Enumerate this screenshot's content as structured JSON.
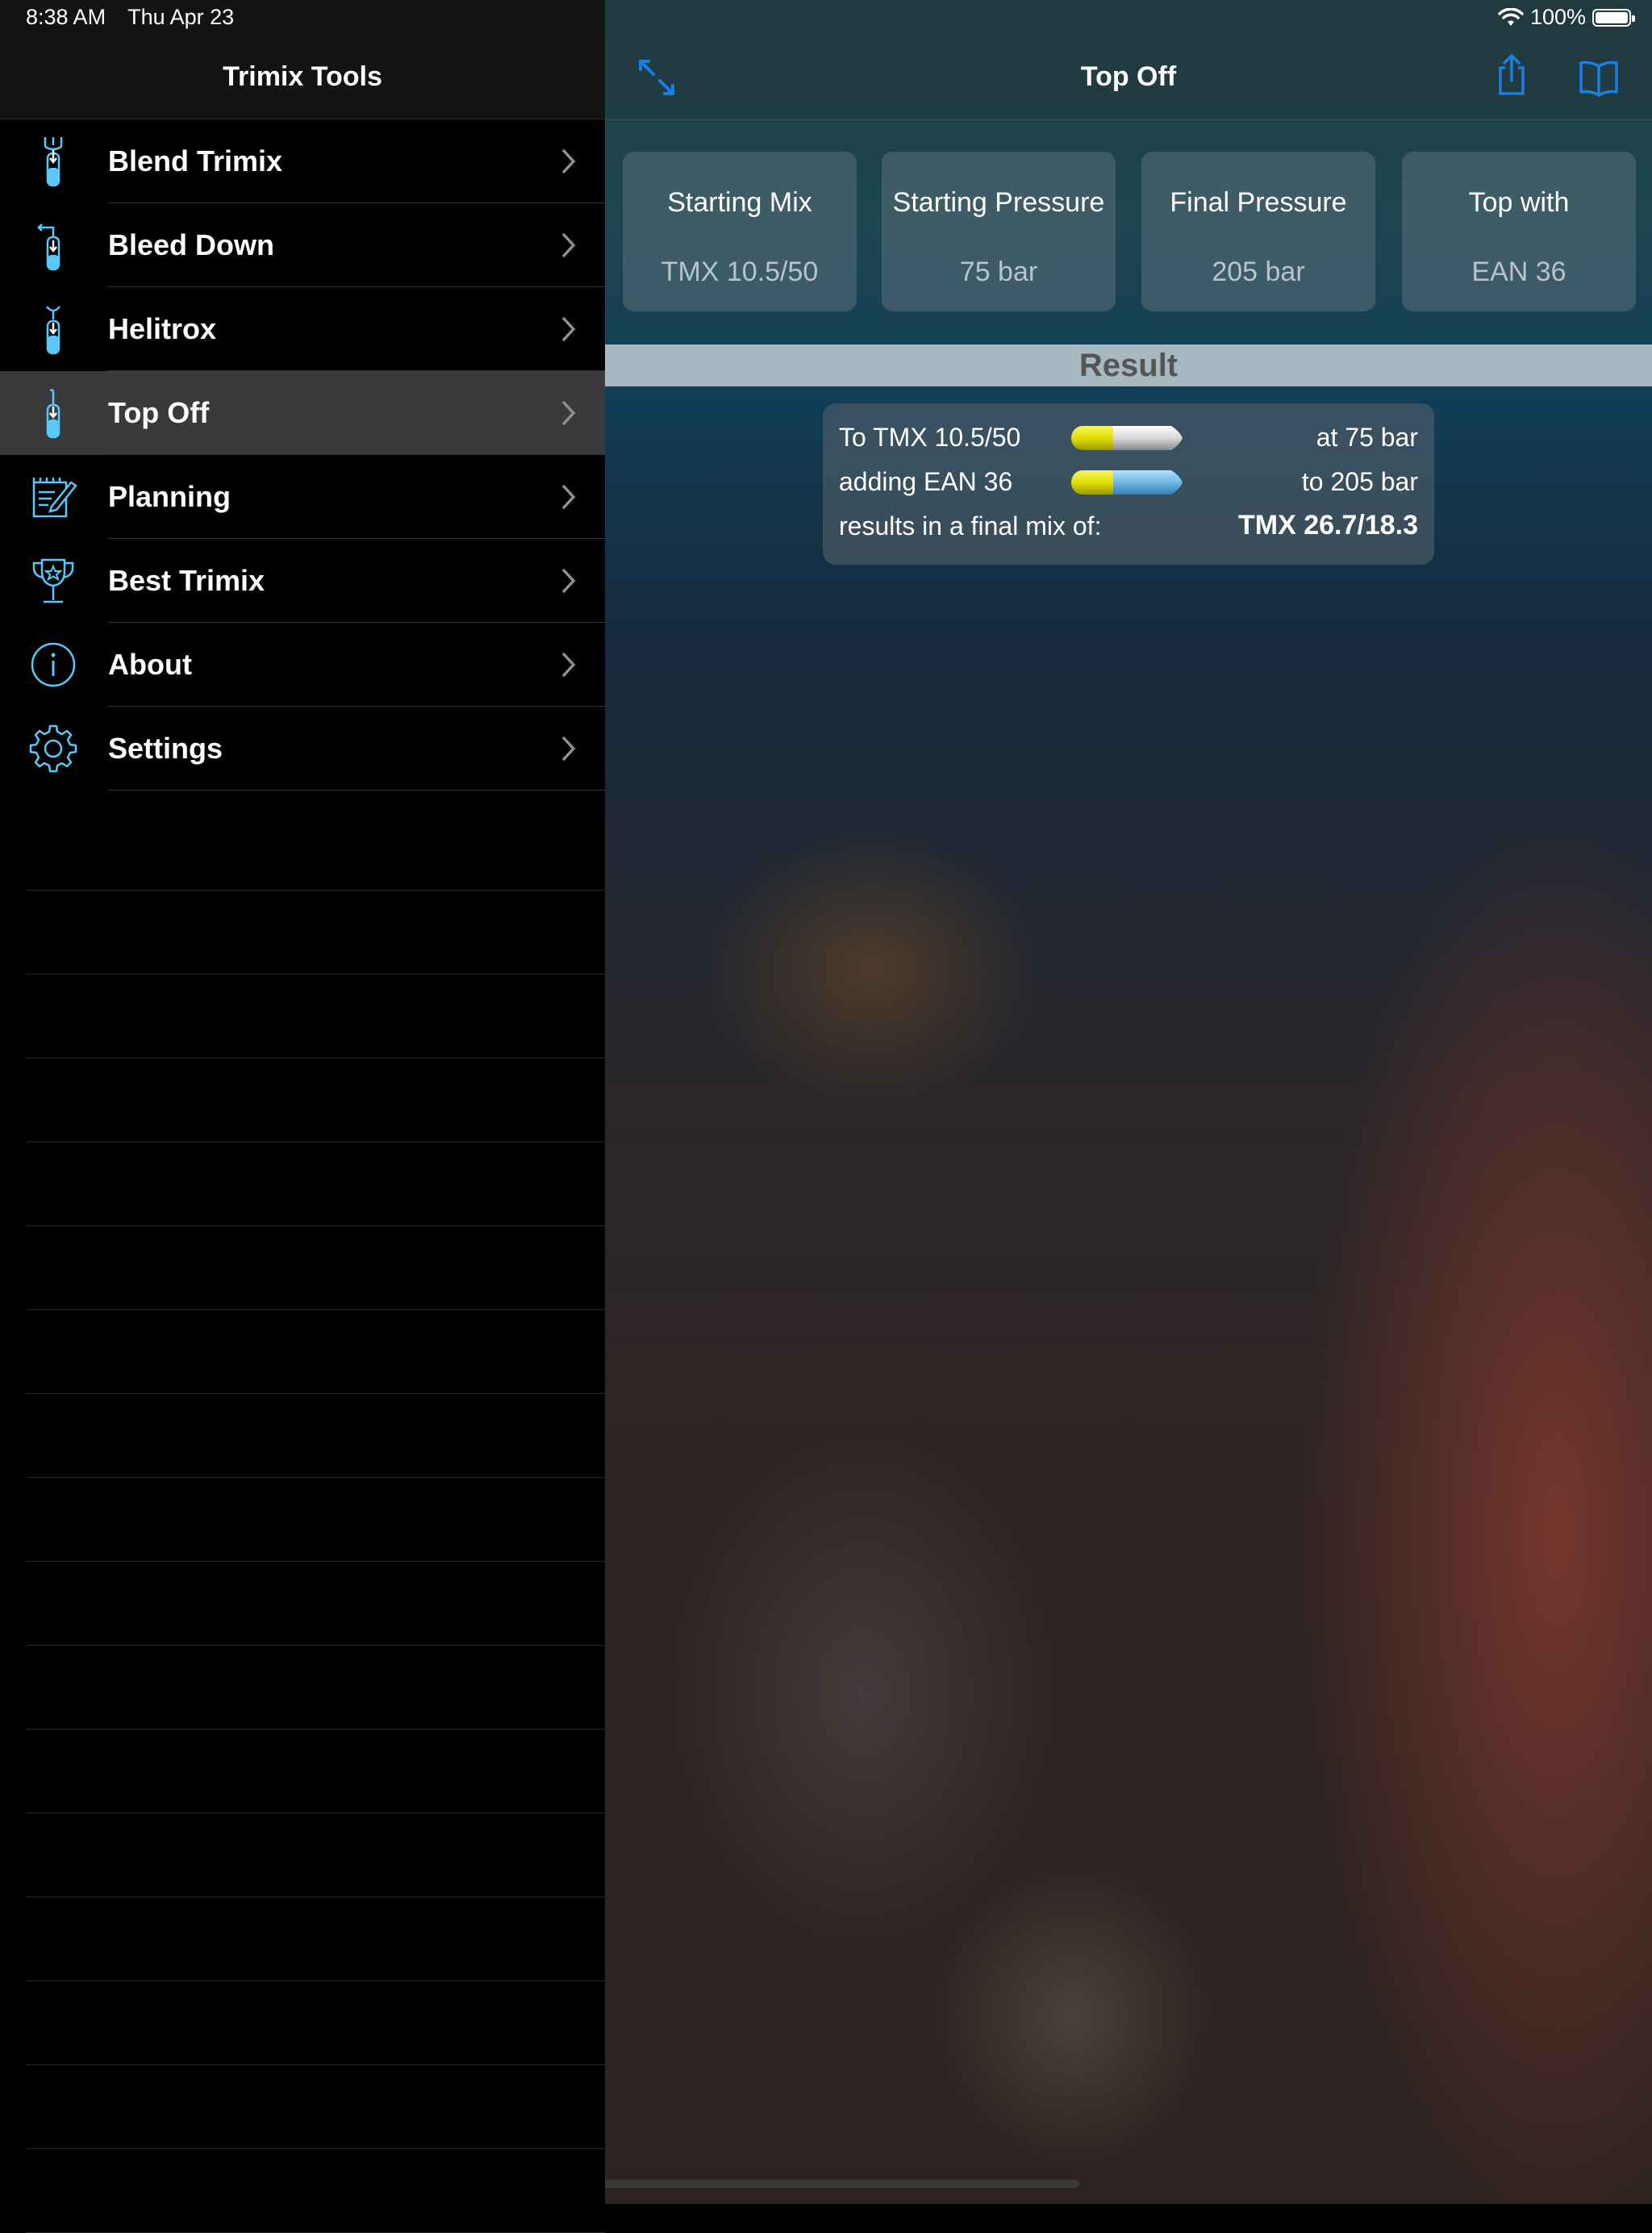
{
  "status_bar": {
    "time": "8:38 AM",
    "date": "Thu Apr 23",
    "battery": "100%"
  },
  "sidebar": {
    "title": "Trimix Tools",
    "items": [
      {
        "label": "Blend Trimix",
        "icon": "blend-tank-icon"
      },
      {
        "label": "Bleed Down",
        "icon": "bleed-tank-icon"
      },
      {
        "label": "Helitrox",
        "icon": "helitrox-tank-icon"
      },
      {
        "label": "Top Off",
        "icon": "topoff-tank-icon",
        "selected": true
      },
      {
        "label": "Planning",
        "icon": "planning-notepad-icon"
      },
      {
        "label": "Best Trimix",
        "icon": "trophy-icon"
      },
      {
        "label": "About",
        "icon": "info-icon"
      },
      {
        "label": "Settings",
        "icon": "gear-icon"
      }
    ]
  },
  "main": {
    "title": "Top Off",
    "cards": [
      {
        "title": "Starting Mix",
        "value": "TMX 10.5/50"
      },
      {
        "title": "Starting Pressure",
        "value": "75 bar"
      },
      {
        "title": "Final Pressure",
        "value": "205 bar"
      },
      {
        "title": "Top with",
        "value": "EAN 36"
      }
    ],
    "result_header": "Result",
    "result": {
      "line1_left": "To TMX 10.5/50",
      "line1_right": "at 75 bar",
      "line2_left": "adding EAN 36",
      "line2_right": "to 205 bar",
      "line3_left": "results in a final mix of:",
      "line3_right": "TMX 26.7/18.3"
    }
  },
  "colors": {
    "accent": "#1a7fe0",
    "icon_blue": "#5ac8fa",
    "tank_yellow": "#e2e000",
    "tank_blue": "#6db7e8",
    "tank_white": "#d8d8d8"
  }
}
